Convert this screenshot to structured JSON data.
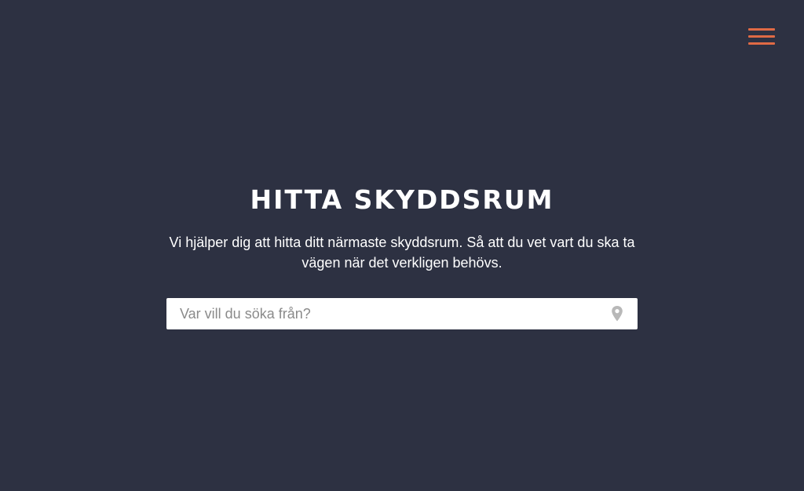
{
  "header": {
    "menu_icon": "hamburger-menu-icon",
    "accent_color": "#e06a45"
  },
  "hero": {
    "title": "HITTA SKYDDSRUM",
    "description": "Vi hjälper dig att hitta ditt närmaste skyddsrum. Så att du vet vart du ska ta vägen när det verkligen behövs."
  },
  "search": {
    "value": "",
    "placeholder": "Var vill du söka från?",
    "location_icon": "map-pin-icon"
  },
  "theme": {
    "background": "#2d3142",
    "text": "#ffffff",
    "input_background": "#ffffff",
    "placeholder_color": "#8a8a8a",
    "icon_color": "#b8b8b8"
  }
}
